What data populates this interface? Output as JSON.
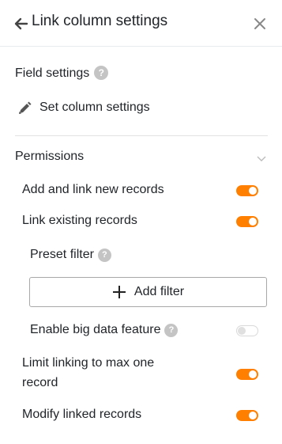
{
  "header": {
    "title": "Link column settings",
    "back_icon": "arrow-left-icon",
    "close_icon": "close-icon"
  },
  "field_settings": {
    "title": "Field settings",
    "help": "?",
    "action_label": "Set column settings",
    "action_icon": "pencil-icon"
  },
  "permissions": {
    "title": "Permissions",
    "collapse_icon": "chevron-down-icon",
    "items": [
      {
        "label": "Add and link new records",
        "enabled": true
      },
      {
        "label": "Link existing records",
        "enabled": true
      }
    ],
    "preset_filter": {
      "label": "Preset filter",
      "help": "?",
      "button_label": "Add filter",
      "button_icon": "plus-icon"
    },
    "big_data": {
      "label": "Enable big data feature",
      "help": "?",
      "enabled": false
    },
    "limit": {
      "label": "Limit linking to max one record",
      "enabled": true
    },
    "modify": {
      "label": "Modify linked records",
      "enabled": true
    }
  },
  "colors": {
    "toggle_on": "#ff8000",
    "toggle_off_border": "#d9d9d9",
    "help_icon": "#c4c4c4"
  }
}
